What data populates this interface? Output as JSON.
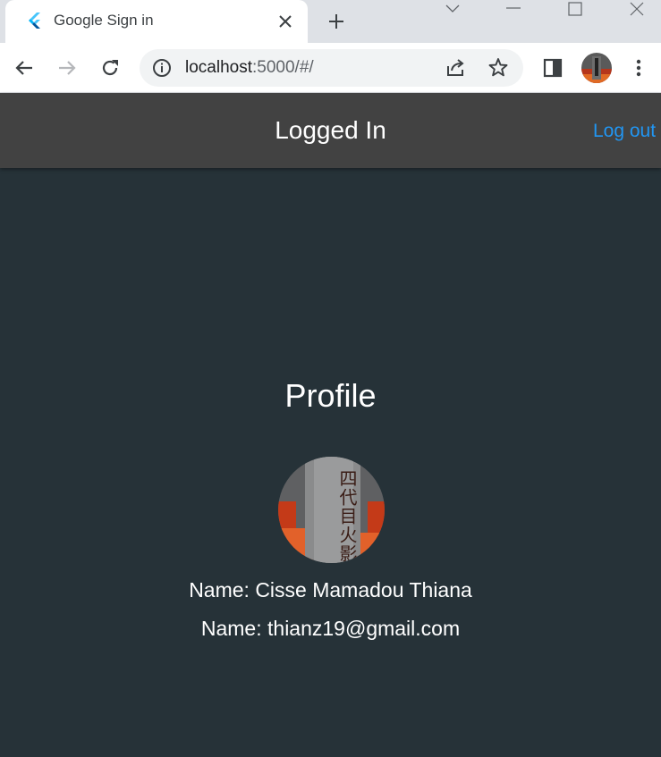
{
  "browser": {
    "tab": {
      "title": "Google Sign in"
    },
    "url": {
      "host": "localhost",
      "rest": ":5000/#/"
    }
  },
  "appbar": {
    "title": "Logged In",
    "logout_label": "Log out"
  },
  "profile": {
    "heading": "Profile",
    "name_line": "Name: Cisse Mamadou Thiana",
    "email_line": "Name: thianz19@gmail.com",
    "avatar_glyphs": "四代目火影"
  },
  "colors": {
    "page_bg": "#263238",
    "appbar_bg": "#424242",
    "link": "#2196f3"
  }
}
